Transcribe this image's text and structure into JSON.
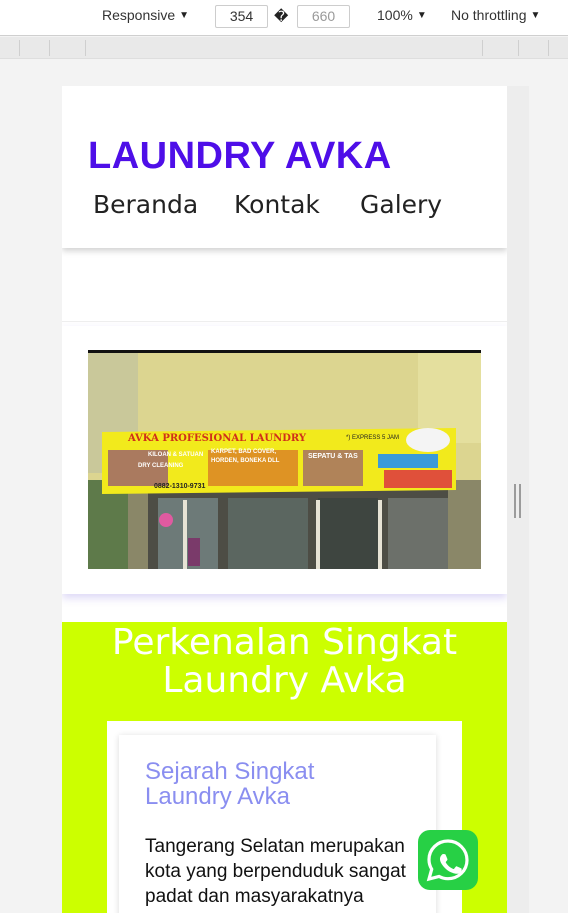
{
  "devtools": {
    "device": "Responsive",
    "width": "354",
    "separator": "�",
    "height": "660",
    "zoom": "100%",
    "throttle": "No throttling"
  },
  "site": {
    "brand": "LAUNDRY AVKA",
    "nav": [
      "Beranda",
      "Kontak",
      "Galery"
    ],
    "banner": {
      "title": "AVKA PROFESIONAL LAUNDRY",
      "express": "*) EXPRESS 5 JAM",
      "services": [
        "KILOAN & SATUAN",
        "KARPET, BAD COVER,",
        "HORDEN, BONEKA DLL",
        "SEPATU & TAS",
        "DRY CLEANING"
      ],
      "phone": "0882-1310-9731"
    },
    "intro_title": "Perkenalan Singkat Laundry Avka",
    "card": {
      "heading": "Sejarah Singkat Laundry Avka",
      "body": "Tangerang Selatan merupakan kota yang berpenduduk sangat padat dan masyarakatnya"
    },
    "whatsapp_icon": "whatsapp-icon"
  },
  "colors": {
    "brand": "#4e0ee8",
    "intro_bg": "#ccff00",
    "card_heading": "#8a8ef0",
    "whatsapp": "#27d045"
  }
}
